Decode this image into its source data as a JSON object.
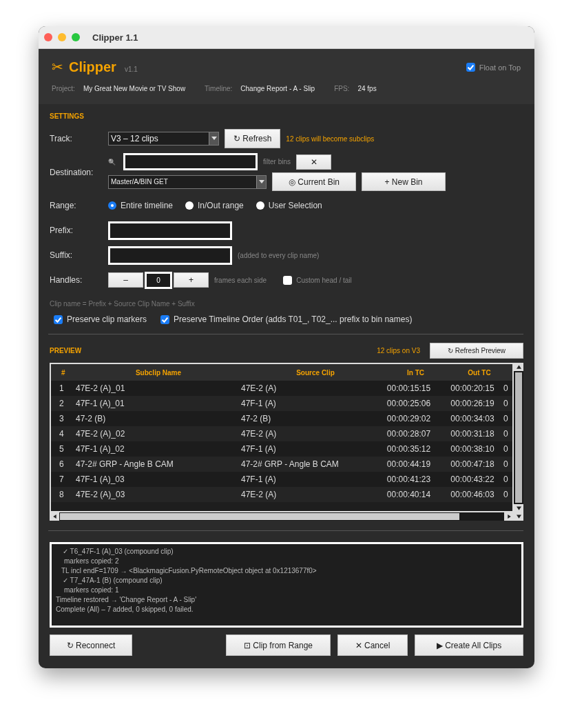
{
  "window": {
    "title": "Clipper 1.1"
  },
  "header": {
    "logo_glyph": "✂",
    "app_name": "Clipper",
    "version": "v1.1",
    "float_on_top": {
      "label": "Float on Top",
      "checked": true
    },
    "info": [
      {
        "label": "Project:",
        "value": "My Great New Movie or TV Show"
      },
      {
        "label": "Timeline:",
        "value": "Change Report - A - Slip"
      },
      {
        "label": "FPS:",
        "value": "24 fps"
      }
    ]
  },
  "settings": {
    "heading": "SETTINGS",
    "track": {
      "label": "Track:",
      "value": "V3  –  12 clips",
      "refresh_button": "↻ Refresh",
      "note": "12 clips will become subclips"
    },
    "destination": {
      "label": "Destination:",
      "search_glyph": "🔍",
      "filter_hint": "filter bins",
      "clear_button": "✕",
      "bin_value": "Master/A/BIN GET",
      "current_bin_button": "◎ Current Bin",
      "new_bin_button": "+ New Bin"
    },
    "range": {
      "label": "Range:",
      "options": [
        {
          "label": "Entire timeline",
          "selected": true
        },
        {
          "label": "In/Out range",
          "selected": false
        },
        {
          "label": "User Selection",
          "selected": false
        }
      ]
    },
    "prefix": {
      "label": "Prefix:"
    },
    "suffix": {
      "label": "Suffix:",
      "note": "(added to every clip name)"
    },
    "handles": {
      "label": "Handles:",
      "minus": "–",
      "value": "0",
      "plus": "+",
      "note": "frames each side",
      "custom": {
        "label": "Custom head / tail",
        "checked": false
      }
    },
    "formula": "Clip name = Prefix + Source Clip Name + Suffix",
    "options": [
      {
        "label": "Preserve clip markers",
        "checked": true
      },
      {
        "label": "Preserve Timeline Order  (adds T01_, T02_... prefix to bin names)",
        "checked": true
      }
    ]
  },
  "preview": {
    "heading": "PREVIEW",
    "count": "12 clips on V3",
    "refresh_button": "↻ Refresh Preview",
    "columns": [
      "#",
      "Subclip Name",
      "Source Clip",
      "In TC",
      "Out TC"
    ],
    "rows": [
      [
        "1",
        "47E-2 (A)_01",
        "47E-2 (A)",
        "00:00:15:15",
        "00:00:20:15",
        "0"
      ],
      [
        "2",
        "47F-1 (A)_01",
        "47F-1 (A)",
        "00:00:25:06",
        "00:00:26:19",
        "0"
      ],
      [
        "3",
        "47-2 (B)",
        "47-2 (B)",
        "00:00:29:02",
        "00:00:34:03",
        "0"
      ],
      [
        "4",
        "47E-2 (A)_02",
        "47E-2 (A)",
        "00:00:28:07",
        "00:00:31:18",
        "0"
      ],
      [
        "5",
        "47F-1 (A)_02",
        "47F-1 (A)",
        "00:00:35:12",
        "00:00:38:10",
        "0"
      ],
      [
        "6",
        "47-2# GRP - Angle B CAM",
        "47-2# GRP - Angle B CAM",
        "00:00:44:19",
        "00:00:47:18",
        "0"
      ],
      [
        "7",
        "47F-1 (A)_03",
        "47F-1 (A)",
        "00:00:41:23",
        "00:00:43:22",
        "0"
      ],
      [
        "8",
        "47E-2 (A)_03",
        "47E-2 (A)",
        "00:00:40:14",
        "00:00:46:03",
        "0"
      ]
    ]
  },
  "log": [
    {
      "kind": "entry",
      "text": "✓ T6_47F-1 (A)_03  (compound clip)"
    },
    {
      "kind": "detail",
      "text": "markers copied: 2"
    },
    {
      "kind": "note",
      "text": "TL incl endF=1709  → <BlackmagicFusion.PyRemoteObject object at 0x1213677f0>"
    },
    {
      "kind": "entry",
      "text": "✓ T7_47A-1 (B)  (compound clip)"
    },
    {
      "kind": "detail",
      "text": "markers copied: 1"
    },
    {
      "kind": "summary",
      "text": "Timeline restored → 'Change Report - A - Slip'"
    },
    {
      "kind": "summary",
      "text": "Complete (All) – 7 added, 0 skipped, 0 failed."
    }
  ],
  "footer": {
    "reconnect_button": "↻ Reconnect",
    "clip_range_button": "⊡ Clip from Range",
    "cancel_button": "✕ Cancel",
    "create_button": "▶ Create All Clips"
  }
}
